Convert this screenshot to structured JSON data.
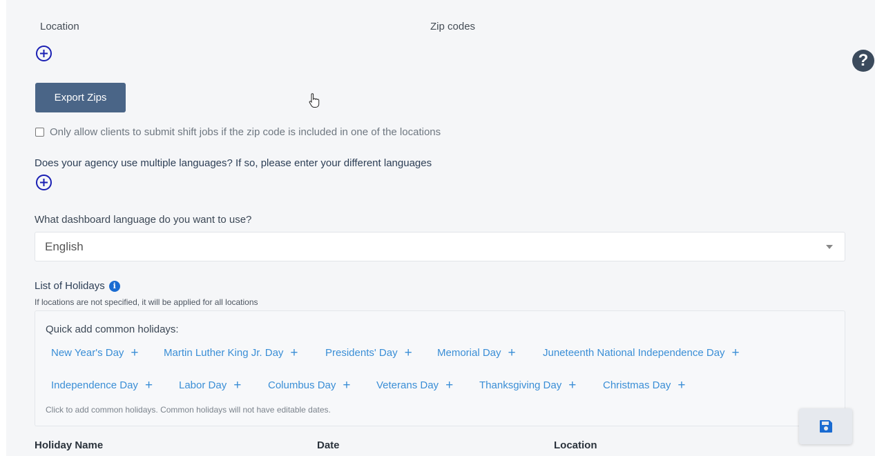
{
  "locations": {
    "col_location": "Location",
    "col_zip": "Zip codes",
    "add_icon": "plus-circle-icon",
    "export_label": "Export Zips",
    "restrict_checkbox_label": "Only allow clients to submit shift jobs if the zip code is included in one of the locations",
    "restrict_checked": false
  },
  "help": {
    "icon": "question-icon",
    "glyph": "?"
  },
  "languages": {
    "question": "Does your agency use multiple languages? If so, please enter your different languages",
    "add_icon": "plus-circle-icon"
  },
  "dashboard_language": {
    "question": "What dashboard language do you want to use?",
    "selected": "English"
  },
  "holidays": {
    "title": "List of Holidays",
    "info_glyph": "i",
    "note": "If locations are not specified, it will be applied for all locations",
    "quick_title": "Quick add common holidays:",
    "plus_glyph": "+",
    "row1": [
      "New Year's Day",
      "Martin Luther King Jr. Day",
      "Presidents' Day",
      "Memorial Day",
      "Juneteenth National Independence Day"
    ],
    "row2": [
      "Independence Day",
      "Labor Day",
      "Columbus Day",
      "Veterans Day",
      "Thanksgiving Day",
      "Christmas Day"
    ],
    "hint": "Click to add common holidays. Common holidays will not have editable dates.",
    "table_headers": [
      "Holiday Name",
      "Date",
      "Location"
    ]
  },
  "colors": {
    "accent_blue": "#3a8ed6",
    "button_blue": "#4a6587",
    "circle_blue": "#1a1fb3",
    "save_icon_blue": "#1a6bd1"
  }
}
